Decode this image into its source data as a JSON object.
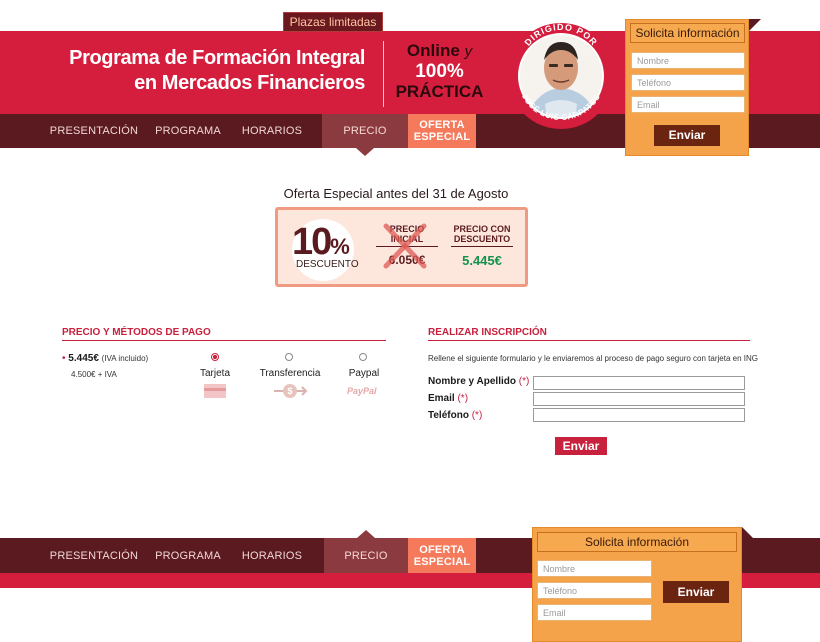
{
  "header": {
    "badge_top": "Plazas limitadas",
    "title_line1": "Programa de Formación Integral",
    "title_line2": "en Mercados Financieros",
    "online": "Online",
    "online_y": "y",
    "pct100": "100%",
    "practica": "PRÁCTICA",
    "dirigido": "DIRIGIDO POR",
    "author": "JOSÉ LUIS CÁRPATOS"
  },
  "nav": {
    "items": [
      "PRESENTACIÓN",
      "PROGRAMA",
      "HORARIOS",
      "PRECIO"
    ],
    "oferta_line1": "OFERTA",
    "oferta_line2": "ESPECIAL",
    "active": "PRECIO"
  },
  "solicita_top": {
    "title": "Solicita información",
    "nombre_placeholder": "Nombre",
    "telefono_placeholder": "Teléfono",
    "email_placeholder": "Email",
    "button": "Enviar"
  },
  "oferta": {
    "title": "Oferta Especial antes del 31 de Agosto",
    "pct_num": "10",
    "pct_sym": "%",
    "descuento": "DESCUENTO",
    "precio_inicial_h1": "PRECIO",
    "precio_inicial_h2": "INICIAL",
    "precio_inicial": "6.050€",
    "precio_desc_h1": "PRECIO CON",
    "precio_desc_h2": "DESCUENTO",
    "precio_descuento": "5.445€"
  },
  "precio": {
    "heading": "PRECIO Y MÉTODOS DE PAGO",
    "bullet": "•",
    "price": "5.445€",
    "iva_incl": "(IVA incluido)",
    "sub_price": "4.500€ + IVA",
    "methods": [
      {
        "label": "Tarjeta",
        "selected": true
      },
      {
        "label": "Transferencia",
        "selected": false
      },
      {
        "label": "Paypal",
        "selected": false
      }
    ],
    "paypal_logo": "PayPal",
    "currency_glyph": "$"
  },
  "inscripcion": {
    "heading": "REALIZAR INSCRIPCIÓN",
    "intro": "Rellene el siguiente formulario y le enviaremos al proceso de pago seguro con tarjeta en ING",
    "fields": [
      {
        "label": "Nombre y Apellido",
        "req": "(*)"
      },
      {
        "label": "Email",
        "req": "(*)"
      },
      {
        "label": "Teléfono",
        "req": "(*)"
      }
    ],
    "button": "Enviar"
  },
  "footer": {
    "solicita_title": "Solicita información",
    "nombre_placeholder": "Nombre",
    "telefono_placeholder": "Teléfono",
    "email_placeholder": "Email",
    "button": "Enviar"
  },
  "colors": {
    "brand_red": "#d51d3d",
    "dark_maroon": "#5a1a1f",
    "orange": "#f4a34a",
    "discount_green": "#13924a"
  }
}
